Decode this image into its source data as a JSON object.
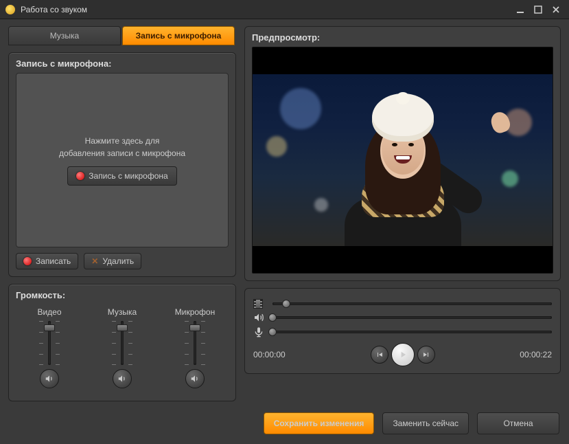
{
  "window": {
    "title": "Работа со звуком"
  },
  "tabs": {
    "music": "Музыка",
    "mic": "Запись с микрофона",
    "active": "mic"
  },
  "mic_panel": {
    "title": "Запись с микрофона:",
    "hint_line1": "Нажмите здесь для",
    "hint_line2": "добавления записи с микрофона",
    "record_btn": "Запись с микрофона",
    "record_action": "Записать",
    "delete_action": "Удалить"
  },
  "volume_panel": {
    "title": "Громкость:",
    "video": "Видео",
    "music": "Музыка",
    "mic": "Микрофон",
    "video_level": 0.85,
    "music_level": 0.85,
    "mic_level": 0.85
  },
  "preview": {
    "title": "Предпросмотр:",
    "seek_pos": 0.05,
    "vol_pos": 0.0,
    "mic_pos": 0.0,
    "time_current": "00:00:00",
    "time_total": "00:00:22"
  },
  "footer": {
    "save": "Сохранить изменения",
    "replace": "Заменить сейчас",
    "cancel": "Отмена"
  }
}
